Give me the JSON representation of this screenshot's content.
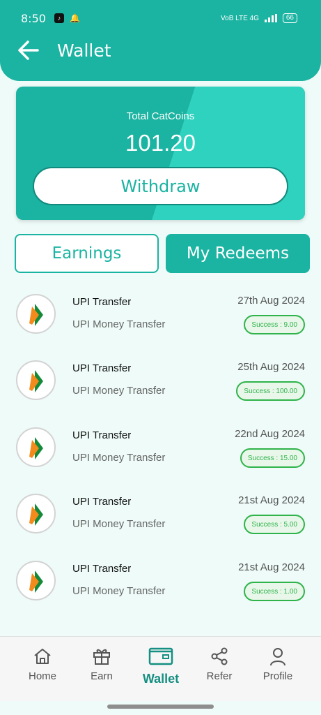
{
  "status_bar": {
    "time": "8:50",
    "network": "VoB LTE 4G",
    "battery": "66"
  },
  "header": {
    "title": "Wallet"
  },
  "balance": {
    "label": "Total CatCoins",
    "value": "101.20",
    "withdraw_label": "Withdraw"
  },
  "tabs": [
    {
      "label": "Earnings"
    },
    {
      "label": "My Redeems"
    }
  ],
  "transactions": [
    {
      "title": "UPI Transfer",
      "subtitle": "UPI Money Transfer",
      "date": "27th Aug 2024",
      "status": "Success : 9.00"
    },
    {
      "title": "UPI Transfer",
      "subtitle": "UPI Money Transfer",
      "date": "25th Aug 2024",
      "status": "Success : 100.00"
    },
    {
      "title": "UPI Transfer",
      "subtitle": "UPI Money Transfer",
      "date": "22nd Aug 2024",
      "status": "Success : 15.00"
    },
    {
      "title": "UPI Transfer",
      "subtitle": "UPI Money Transfer",
      "date": "21st Aug 2024",
      "status": "Success : 5.00"
    },
    {
      "title": "UPI Transfer",
      "subtitle": "UPI Money Transfer",
      "date": "21st Aug 2024",
      "status": "Success : 1.00"
    }
  ],
  "bottom_nav": [
    {
      "label": "Home",
      "icon": "home-icon"
    },
    {
      "label": "Earn",
      "icon": "gift-icon"
    },
    {
      "label": "Wallet",
      "icon": "wallet-icon",
      "active": true
    },
    {
      "label": "Refer",
      "icon": "share-icon"
    },
    {
      "label": "Profile",
      "icon": "profile-icon"
    }
  ],
  "colors": {
    "primary": "#1bb3a1",
    "primary_light": "#2fd2bf",
    "success": "#2fb34a",
    "background": "#eefbf8"
  }
}
